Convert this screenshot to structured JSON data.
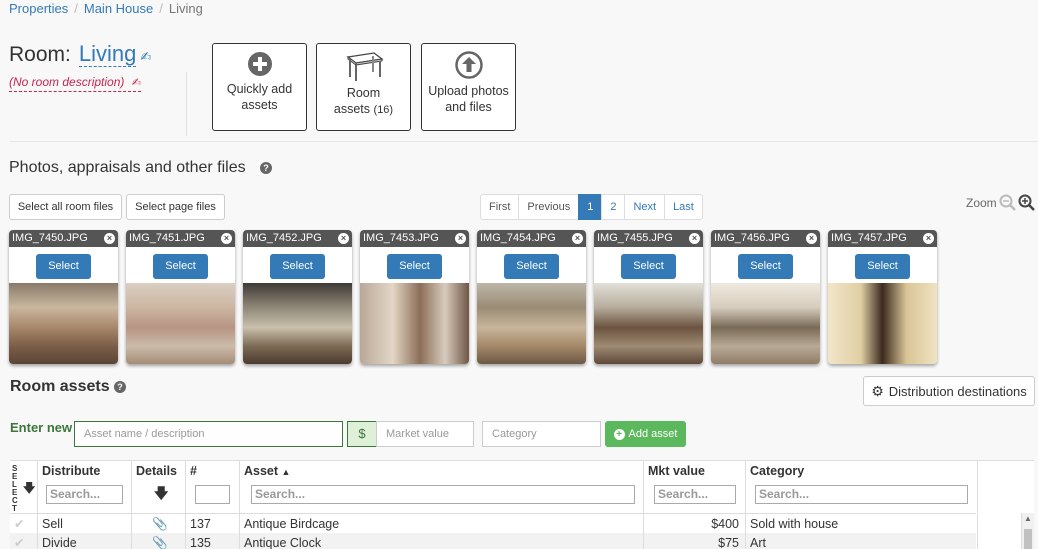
{
  "breadcrumb": {
    "items": [
      "Properties",
      "Main House"
    ],
    "current": "Living"
  },
  "room": {
    "label": "Room:",
    "name": "Living",
    "description": "(No room description)"
  },
  "actions": {
    "quick_add_line1": "Quickly add",
    "quick_add_line2": "assets",
    "room_assets_line1": "Room",
    "room_assets_line2": "assets",
    "room_assets_count": "(16)",
    "upload_line1": "Upload photos",
    "upload_line2": "and files"
  },
  "files": {
    "title": "Photos, appraisals and other files",
    "select_all": "Select all room files",
    "select_page": "Select page files",
    "pager": [
      "First",
      "Previous",
      "1",
      "2",
      "Next",
      "Last"
    ],
    "zoom_label": "Zoom",
    "select_label": "Select",
    "thumbnails": [
      "IMG_7450.JPG",
      "IMG_7451.JPG",
      "IMG_7452.JPG",
      "IMG_7453.JPG",
      "IMG_7454.JPG",
      "IMG_7455.JPG",
      "IMG_7456.JPG",
      "IMG_7457.JPG"
    ]
  },
  "assets": {
    "title": "Room assets",
    "distribution_button": "Distribution destinations",
    "enter_new": "Enter new",
    "name_placeholder": "Asset name / description",
    "currency": "$",
    "value_placeholder": "Market value",
    "category_placeholder": "Category",
    "add_button": "Add asset",
    "columns": {
      "select": "SELECT",
      "distribute": "Distribute",
      "details": "Details",
      "number": "#",
      "asset": "Asset",
      "sort_indicator": "▲",
      "value": "Mkt value",
      "category": "Category"
    },
    "search_placeholder": "Search...",
    "rows": [
      {
        "distribute": "Sell",
        "number": "137",
        "asset": "Antique Birdcage",
        "value": "$400",
        "category": "Sold with house"
      },
      {
        "distribute": "Divide",
        "number": "135",
        "asset": "Antique Clock",
        "value": "$75",
        "category": "Art"
      }
    ]
  },
  "colors": {
    "link": "#337ab7",
    "success": "#5cb85c",
    "success_dark": "#3c763d",
    "danger": "#c7254e"
  }
}
